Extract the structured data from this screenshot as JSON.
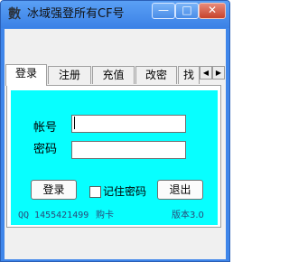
{
  "window": {
    "title": "冰域强登所有CF号",
    "icon": "seal-glyph-icon",
    "icon_glyph": "數",
    "buttons": {
      "minimize": "—",
      "maximize": "□",
      "close": "✕"
    }
  },
  "tabs": [
    {
      "label": "登录",
      "active": true
    },
    {
      "label": "注册",
      "active": false
    },
    {
      "label": "充值",
      "active": false
    },
    {
      "label": "改密",
      "active": false
    },
    {
      "label": "找",
      "active": false
    }
  ],
  "tab_scroll": {
    "left": "◀",
    "right": "▶"
  },
  "form": {
    "account_label": "帐号",
    "password_label": "密码",
    "account_value": "",
    "password_value": "",
    "login_button": "登录",
    "remember_label": "记住密码",
    "remember_checked": false,
    "exit_button": "退出"
  },
  "footer": {
    "qq": "QQ 1455421499",
    "buy": "购卡",
    "version": "版本3.0"
  },
  "colors": {
    "panel_bg": "#07ffff",
    "titlebar": "#3b82e6",
    "footer_text": "#2a4a7a"
  }
}
